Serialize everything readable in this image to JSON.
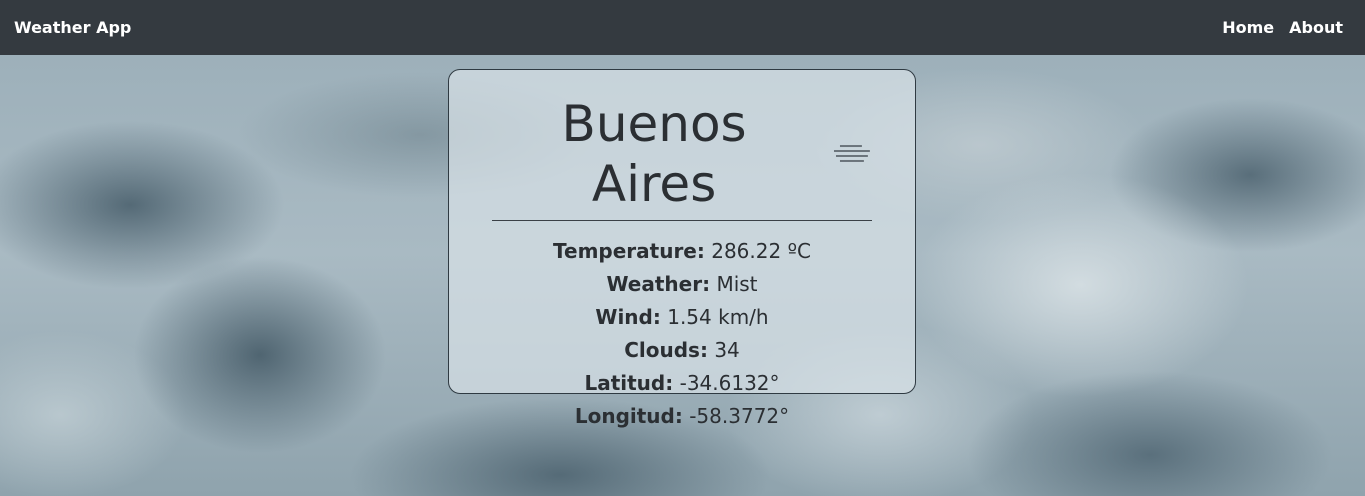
{
  "navbar": {
    "brand": "Weather App",
    "links": [
      "Home",
      "About"
    ]
  },
  "card": {
    "city": "Buenos Aires",
    "icon": "mist-icon",
    "details": [
      {
        "label": "Temperature:",
        "value": "286.22 ºC"
      },
      {
        "label": "Weather:",
        "value": "Mist"
      },
      {
        "label": "Wind:",
        "value": "1.54 km/h"
      },
      {
        "label": "Clouds:",
        "value": "34"
      },
      {
        "label": "Latitud:",
        "value": "-34.6132°"
      },
      {
        "label": "Longitud:",
        "value": "-58.3772°"
      }
    ]
  },
  "colors": {
    "navbar_bg": "#343a40",
    "nav_text": "#ffffff",
    "card_text": "#2b2f33"
  }
}
